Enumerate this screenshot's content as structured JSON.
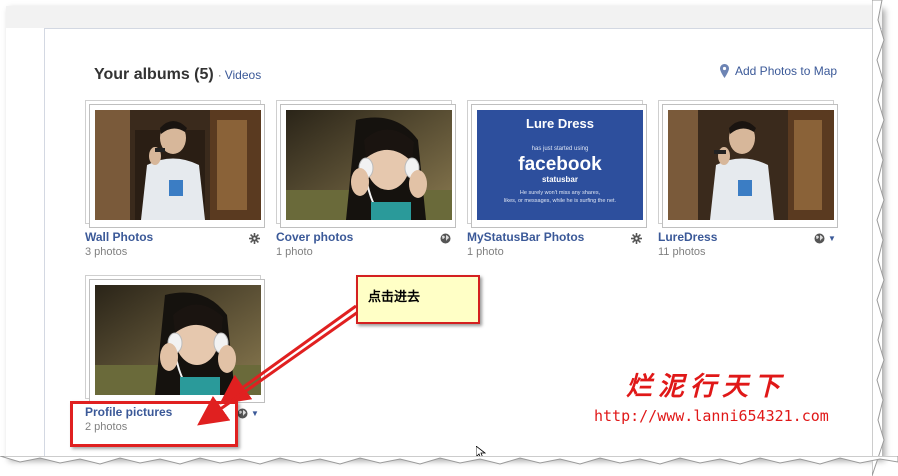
{
  "header": {
    "title": "Your albums (5)",
    "separator": "·",
    "videos_link": "Videos",
    "map_link": "Add Photos to Map"
  },
  "albums": [
    {
      "title": "Wall Photos",
      "count": "3 photos",
      "privacy_icon": "gear-icon"
    },
    {
      "title": "Cover photos",
      "count": "1 photo",
      "privacy_icon": "globe-icon"
    },
    {
      "title": "MyStatusBar Photos",
      "count": "1 photo",
      "privacy_icon": "gear-icon"
    },
    {
      "title": "LureDress",
      "count": "11 photos",
      "privacy_icon": "globe-icon"
    },
    {
      "title": "Profile pictures",
      "count": "2 photos",
      "privacy_icon": "globe-icon"
    }
  ],
  "statusbar_thumb": {
    "brand": "Lure Dress",
    "line1": "has just started using",
    "logo": "facebook",
    "sub": "statusbar",
    "line2": "He surely won't miss any shares,",
    "line3": "likes, or messages, while he is surfing the net."
  },
  "annotation": {
    "callout_text": "点击进去",
    "color": "#e02020"
  },
  "watermark": {
    "title": "烂泥行天下",
    "url": "http://www.lanni654321.com"
  },
  "colors": {
    "link": "#3b5998",
    "count": "#808080",
    "callout_bg": "#ffffc6"
  }
}
